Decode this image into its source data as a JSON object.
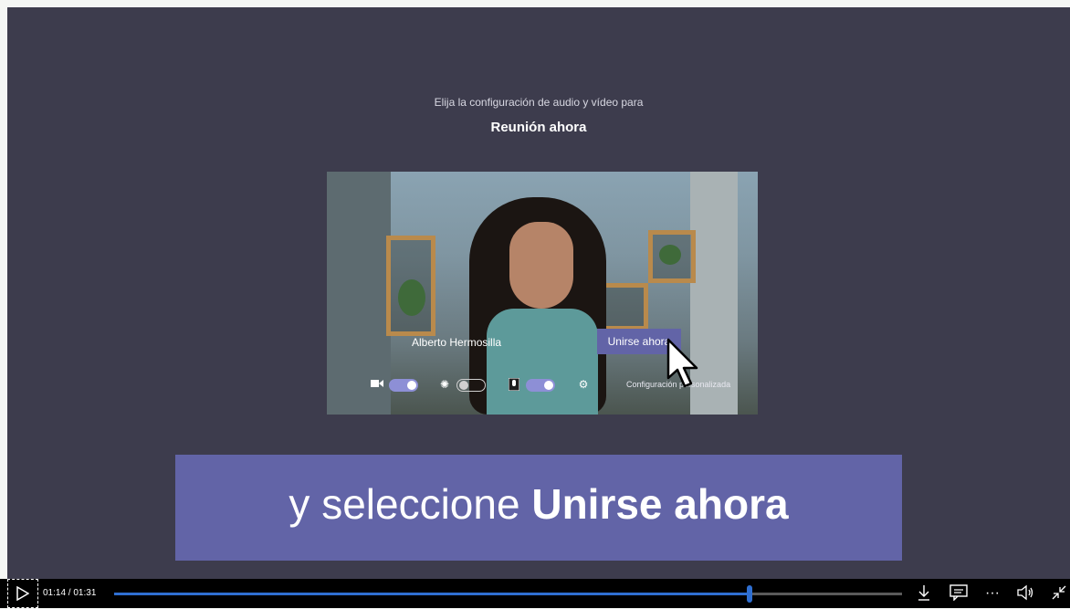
{
  "video": {
    "heading_small": "Elija la configuración de audio y vídeo para",
    "meeting_title": "Reunión ahora",
    "preview": {
      "participant_name": "Alberto Hermosilla",
      "join_button_label": "Unirse ahora",
      "config_label": "Configuración personalizada",
      "camera_toggle": "on",
      "blur_toggle": "off",
      "mic_toggle": "on"
    },
    "caption": {
      "prefix": "y seleccione ",
      "bold": "Unirse ahora"
    },
    "colors": {
      "background": "#3d3c4d",
      "accent": "#6264a7",
      "progress": "#2f6fd1"
    }
  },
  "player": {
    "time": "01:14 / 01:31",
    "progress_fraction": 0.807,
    "icons": [
      "play-icon",
      "download-icon",
      "captions-icon",
      "more-icon",
      "volume-icon",
      "exit-fullscreen-icon"
    ],
    "more_glyph": "···"
  }
}
